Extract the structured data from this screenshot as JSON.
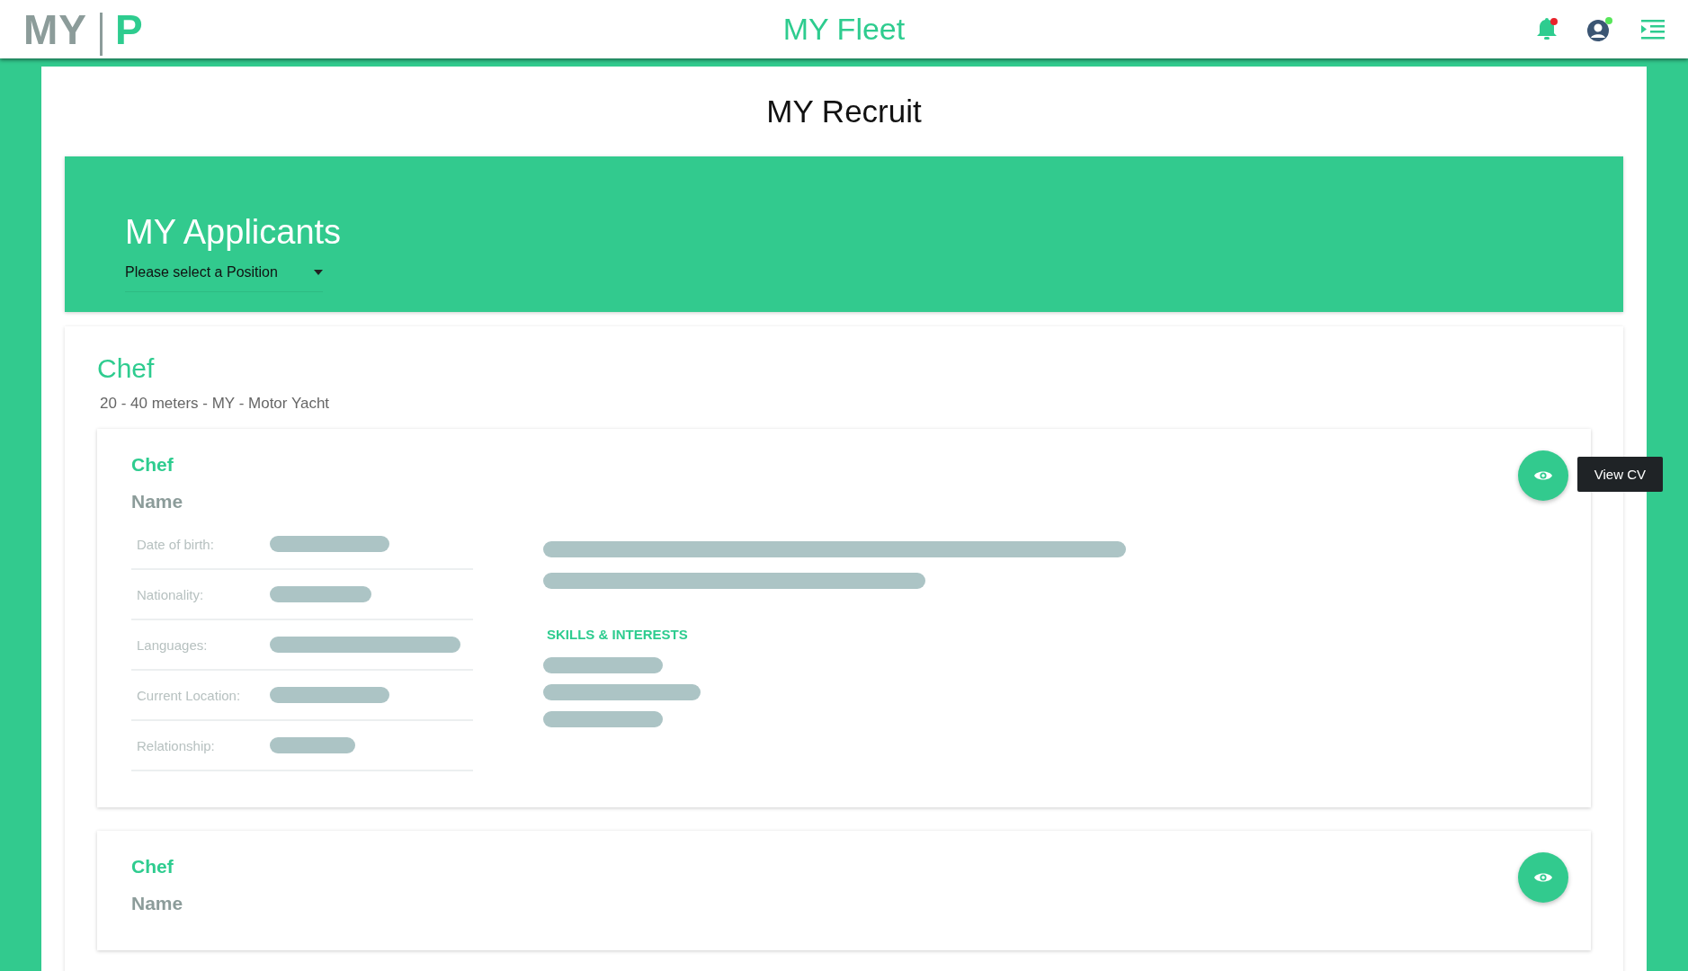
{
  "header": {
    "logo_left": "MY",
    "logo_right": "P",
    "title": "MY Fleet"
  },
  "page_title": "MY Recruit",
  "banner": {
    "title": "MY Applicants",
    "position_select": {
      "value": "Please select a Position"
    }
  },
  "position": {
    "title": "Chef",
    "subtitle": "20 - 40 meters - MY - Motor Yacht",
    "applicants": [
      {
        "role": "Chef",
        "name": "Name",
        "tooltip": "View CV",
        "fields": [
          "Date of birth:",
          "Nationality:",
          "Languages:",
          "Current Location:",
          "Relationship:"
        ],
        "skills_heading": "SKILLS & INTERESTS"
      },
      {
        "role": "Chef",
        "name": "Name"
      }
    ]
  }
}
